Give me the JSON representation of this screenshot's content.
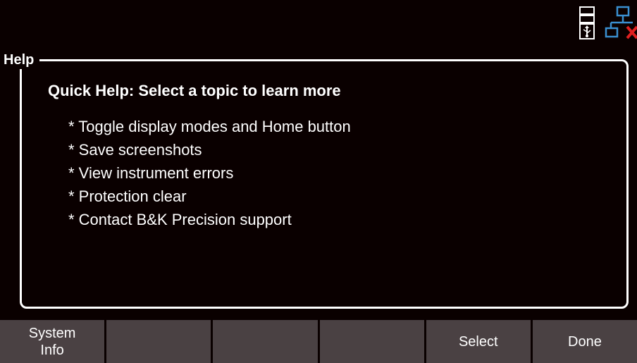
{
  "status_bar": {
    "icons": [
      "usb-icon",
      "network-disconnected-icon"
    ]
  },
  "help_panel": {
    "title": "Help",
    "heading": "Quick Help: Select a topic to learn more",
    "topics": [
      "* Toggle display modes and Home button",
      "* Save screenshots",
      "* View instrument errors",
      "* Protection clear",
      "* Contact B&K Precision support"
    ]
  },
  "softkeys": [
    {
      "label": "System\nInfo"
    },
    {
      "label": ""
    },
    {
      "label": ""
    },
    {
      "label": ""
    },
    {
      "label": "Select"
    },
    {
      "label": "Done"
    }
  ],
  "colors": {
    "background": "#0a0000",
    "softkey_bg": "#4a4143",
    "text": "#ffffff",
    "network_icon_blue": "#3a8fd0",
    "network_icon_red": "#e02020"
  }
}
